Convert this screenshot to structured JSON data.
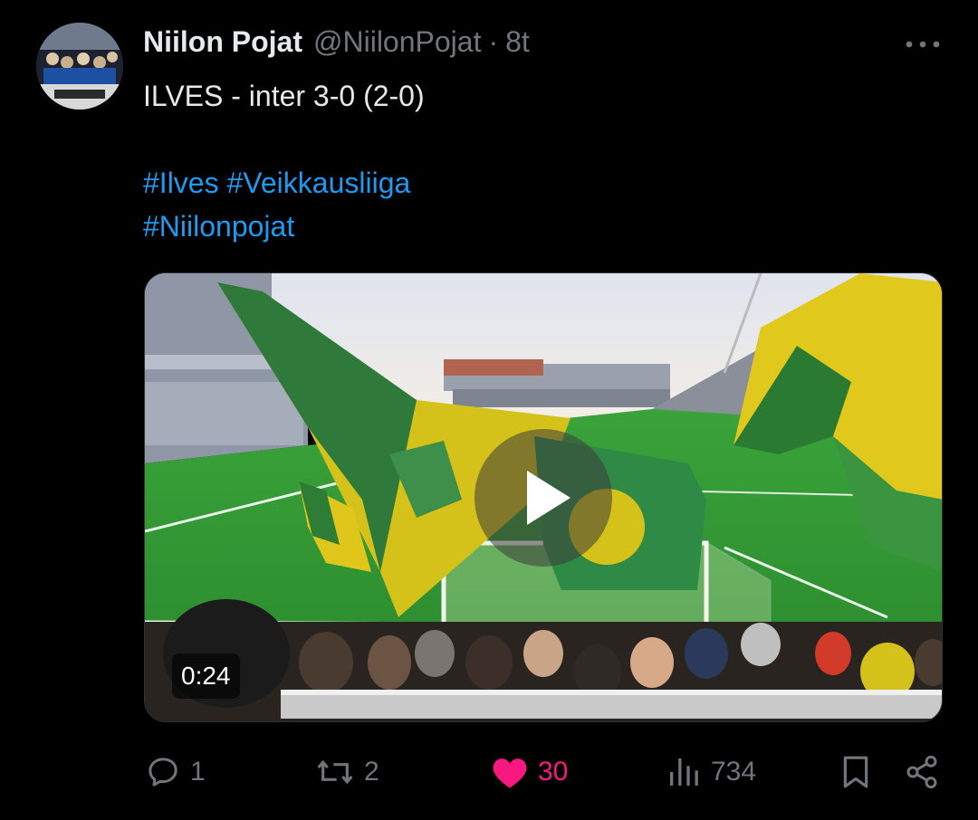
{
  "tweet": {
    "author_name": "Niilon Pojat",
    "handle": "@NiilonPojat",
    "separator": "·",
    "time": "8t",
    "text_lines": [
      "ILVES - inter 3-0 (2-0)"
    ],
    "hashtag_lines": [
      [
        "#Ilves",
        "#Veikkausliiga"
      ],
      [
        "#Niilonpojat"
      ]
    ]
  },
  "video": {
    "duration": "0:24",
    "play_icon": "play-icon"
  },
  "actions": {
    "reply": {
      "icon": "reply-icon",
      "count": "1"
    },
    "repost": {
      "icon": "repost-icon",
      "count": "2"
    },
    "like": {
      "icon": "heart-icon",
      "count": "30",
      "liked": true,
      "color": "#f91880"
    },
    "views": {
      "icon": "views-icon",
      "count": "734"
    },
    "bookmark": {
      "icon": "bookmark-icon"
    },
    "share": {
      "icon": "share-icon"
    }
  },
  "colors": {
    "background": "#000000",
    "text": "#e7e9ea",
    "muted": "#71767b",
    "link": "#1d9bf0",
    "like": "#f91880"
  }
}
